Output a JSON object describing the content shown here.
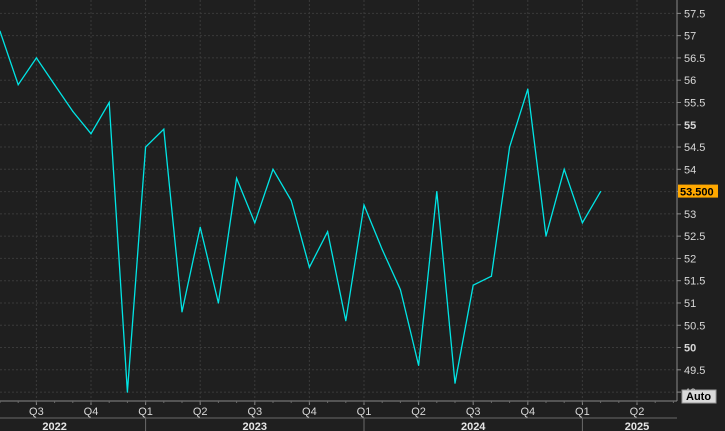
{
  "chart_data": {
    "type": "line",
    "x": [
      "2022-05",
      "2022-06",
      "2022-07",
      "2022-08",
      "2022-09",
      "2022-10",
      "2022-11",
      "2022-12",
      "2023-01",
      "2023-02",
      "2023-03",
      "2023-04",
      "2023-05",
      "2023-06",
      "2023-07",
      "2023-08",
      "2023-09",
      "2023-10",
      "2023-11",
      "2023-12",
      "2024-01",
      "2024-02",
      "2024-03",
      "2024-04",
      "2024-05",
      "2024-06",
      "2024-07",
      "2024-08",
      "2024-09",
      "2024-10",
      "2024-11",
      "2024-12",
      "2025-01",
      "2025-02",
      "2025-03"
    ],
    "series": [
      {
        "values": [
          57.1,
          55.9,
          56.5,
          55.9,
          55.3,
          54.8,
          55.5,
          49.0,
          54.5,
          54.9,
          50.8,
          52.7,
          51.0,
          53.8,
          52.8,
          54.0,
          53.3,
          51.8,
          52.6,
          50.6,
          53.2,
          52.2,
          51.3,
          49.6,
          53.5,
          49.2,
          51.4,
          51.6,
          54.5,
          55.8,
          52.5,
          54.0,
          52.8,
          53.5
        ]
      }
    ],
    "ylim": [
      48.8,
      57.8
    ],
    "yticks": [
      49,
      49.5,
      50,
      50.5,
      51,
      51.5,
      52,
      52.5,
      53,
      53.5,
      54,
      54.5,
      55,
      55.5,
      56,
      56.5,
      57,
      57.5
    ],
    "ytick_labels": [
      "49",
      "49.5",
      "50",
      "50.5",
      "51",
      "51.5",
      "52",
      "52.5",
      "53",
      "53.5",
      "54",
      "54.5",
      "55",
      "55.5",
      "56",
      "56.5",
      "57",
      "57.5"
    ],
    "bold_ticks": [
      "50",
      "55"
    ],
    "xticks": [
      {
        "label": "Q3",
        "date": "2022-07"
      },
      {
        "label": "Q4",
        "date": "2022-10"
      },
      {
        "label": "Q1",
        "date": "2023-01"
      },
      {
        "label": "Q2",
        "date": "2023-04"
      },
      {
        "label": "Q3",
        "date": "2023-07"
      },
      {
        "label": "Q4",
        "date": "2023-10"
      },
      {
        "label": "Q1",
        "date": "2024-01"
      },
      {
        "label": "Q2",
        "date": "2024-04"
      },
      {
        "label": "Q3",
        "date": "2024-07"
      },
      {
        "label": "Q4",
        "date": "2024-10"
      },
      {
        "label": "Q1",
        "date": "2025-01"
      },
      {
        "label": "Q2",
        "date": "2025-04"
      }
    ],
    "years": [
      {
        "label": "2022",
        "date": "2022-08"
      },
      {
        "label": "2023",
        "date": "2023-07"
      },
      {
        "label": "2024",
        "date": "2024-07"
      },
      {
        "label": "2025",
        "date": "2025-04"
      }
    ],
    "last_value_label": "53.500",
    "scale_mode_label": "Auto",
    "grid": true,
    "colors": {
      "line": "#00e5e5",
      "background": "#1f1f1f",
      "grid": "#3a3a3a",
      "text": "#d8d8d8",
      "last_badge": "#ffa800"
    }
  }
}
